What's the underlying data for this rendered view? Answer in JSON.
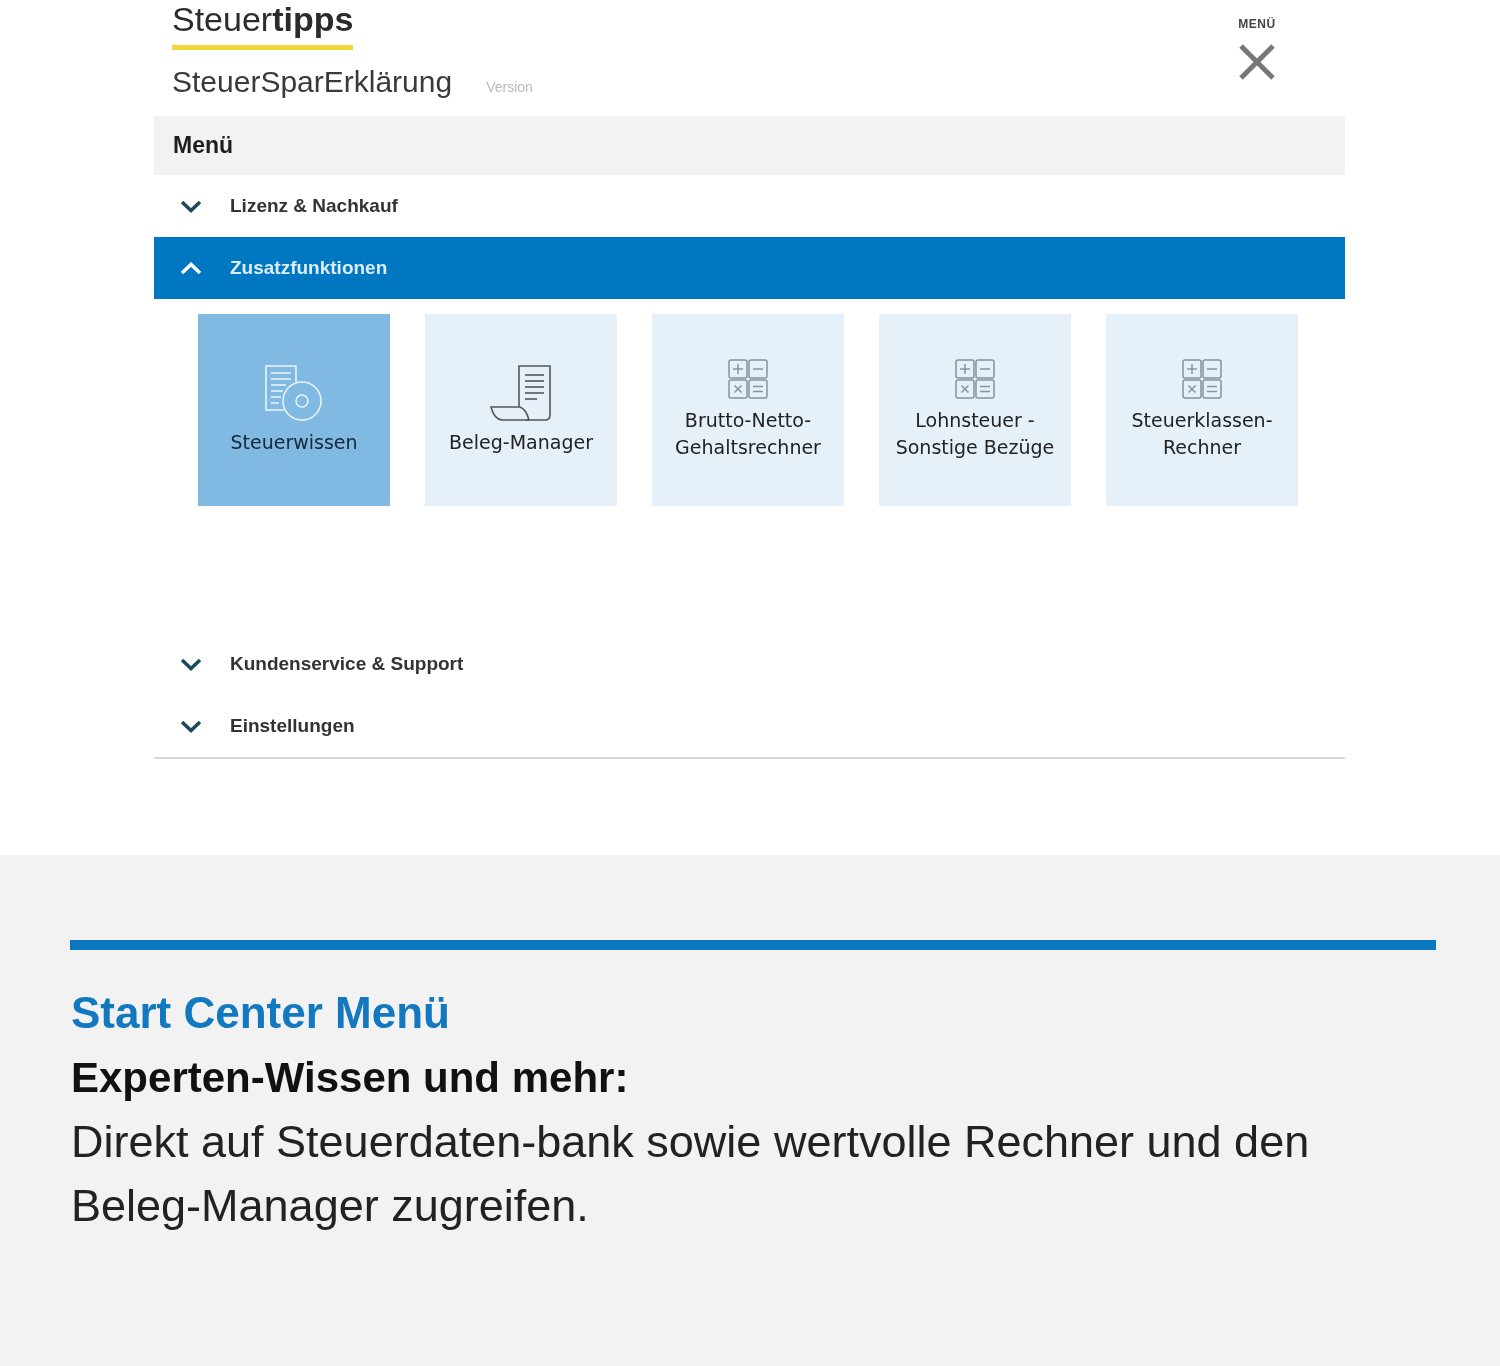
{
  "header": {
    "logo": "Steuer**tipps**",
    "product": "SteuerSparErklärung",
    "version_label": "Version",
    "menu_button": {
      "label": "MENÜ"
    }
  },
  "menu": {
    "title": "Menü",
    "sections": [
      {
        "label": "Lizenz & Nachkauf",
        "expanded": false
      },
      {
        "label": "Zusatzfunktionen",
        "expanded": true,
        "tiles": [
          {
            "label": "Steuerwissen",
            "kind": "knowledge",
            "selected": true
          },
          {
            "label": "Beleg-Manager",
            "kind": "receipt",
            "selected": false
          },
          {
            "label": "Brutto-Netto-Gehaltsrechner",
            "kind": "calculator",
            "selected": false
          },
          {
            "label": "Lohnsteuer - Sonstige Bezüge",
            "kind": "calculator",
            "selected": false
          },
          {
            "label": "Steuerklassen-Rechner",
            "kind": "calculator",
            "selected": false
          }
        ]
      },
      {
        "label": "Kundenservice & Support",
        "expanded": false
      },
      {
        "label": "Einstellungen",
        "expanded": false
      }
    ]
  },
  "caption": {
    "title": "Start Center Menü",
    "subtitle": "Experten-Wissen und mehr:",
    "text": "Direkt auf Steuerdaten-bank sowie wertvolle Rechner und den Beleg-Manager zugreifen."
  }
}
